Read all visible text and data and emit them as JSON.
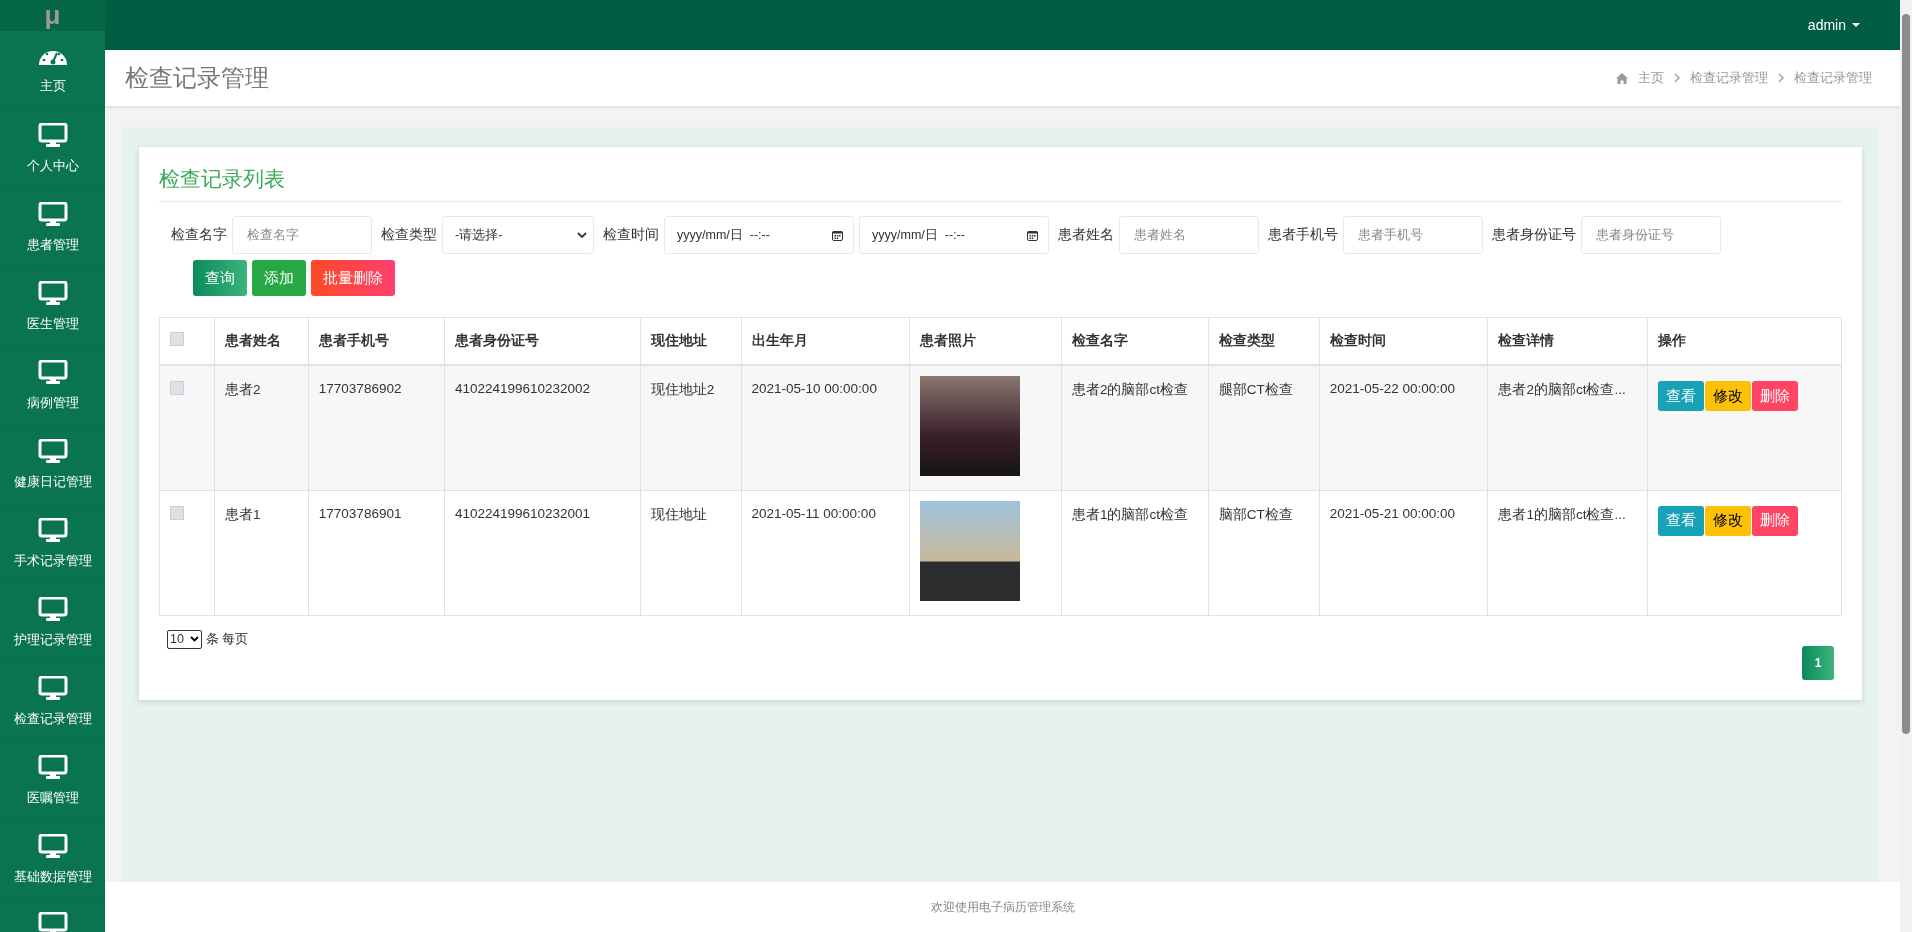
{
  "sidebar": {
    "logo": "μ",
    "items": [
      {
        "label": "主页",
        "kind": "dashboard"
      },
      {
        "label": "个人中心",
        "kind": "monitor"
      },
      {
        "label": "患者管理",
        "kind": "monitor"
      },
      {
        "label": "医生管理",
        "kind": "monitor"
      },
      {
        "label": "病例管理",
        "kind": "monitor"
      },
      {
        "label": "健康日记管理",
        "kind": "monitor"
      },
      {
        "label": "手术记录管理",
        "kind": "monitor"
      },
      {
        "label": "护理记录管理",
        "kind": "monitor"
      },
      {
        "label": "检查记录管理",
        "kind": "monitor"
      },
      {
        "label": "医嘱管理",
        "kind": "monitor"
      },
      {
        "label": "基础数据管理",
        "kind": "monitor"
      }
    ]
  },
  "topbar": {
    "user": "admin"
  },
  "page_header": {
    "title": "检查记录管理",
    "breadcrumbs": [
      "主页",
      "检查记录管理",
      "检查记录管理"
    ]
  },
  "card": {
    "title": "检查记录列表",
    "filters": [
      {
        "kind": "text",
        "label": "检查名字",
        "placeholder": "检查名字"
      },
      {
        "kind": "select",
        "label": "检查类型",
        "value": "-请选择-"
      },
      {
        "kind": "date",
        "label": "检查时间",
        "value": "yyyy/mm/日  --:--"
      },
      {
        "kind": "date",
        "value": "yyyy/mm/日  --:--"
      },
      {
        "kind": "text",
        "label": "患者姓名",
        "placeholder": "患者姓名"
      },
      {
        "kind": "text",
        "label": "患者手机号",
        "placeholder": "患者手机号"
      },
      {
        "kind": "text",
        "label": "患者身份证号",
        "placeholder": "患者身份证号"
      }
    ],
    "buttons": [
      {
        "label": "查询",
        "kind": "search"
      },
      {
        "label": "添加",
        "kind": "add"
      },
      {
        "label": "批量删除",
        "kind": "delete"
      }
    ],
    "table": {
      "select_all": {
        "checked": false
      },
      "columns": [
        "患者姓名",
        "患者手机号",
        "患者身份证号",
        "现住地址",
        "出生年月",
        "患者照片",
        "检查名字",
        "检查类型",
        "检查时间",
        "检查详情",
        "操作"
      ],
      "rows": [
        {
          "checked": false,
          "cells": [
            "患者2",
            "17703786902",
            "410224199610232002",
            "现住地址2",
            "2021-05-10 00:00:00",
            "",
            "患者2的脑部ct检查",
            "腿部CT检查",
            "2021-05-22 00:00:00",
            "患者2的脑部ct检查..."
          ],
          "actions": [
            {
              "label": "查看",
              "kind": "view"
            },
            {
              "label": "修改",
              "kind": "edit"
            },
            {
              "label": "删除",
              "kind": "delete"
            }
          ]
        },
        {
          "checked": false,
          "cells": [
            "患者1",
            "17703786901",
            "410224199610232001",
            "现住地址",
            "2021-05-11 00:00:00",
            "",
            "患者1的脑部ct检查",
            "脑部CT检查",
            "2021-05-21 00:00:00",
            "患者1的脑部ct检查..."
          ],
          "actions": [
            {
              "label": "查看",
              "kind": "view"
            },
            {
              "label": "修改",
              "kind": "edit"
            },
            {
              "label": "删除",
              "kind": "delete"
            }
          ]
        }
      ]
    },
    "pagination": {
      "page_size": "10",
      "page_size_label": "条 每页",
      "pages": [
        {
          "label": "1",
          "selected": true
        }
      ]
    }
  },
  "footer": {
    "text": "欢迎使用电子病历管理系统"
  }
}
